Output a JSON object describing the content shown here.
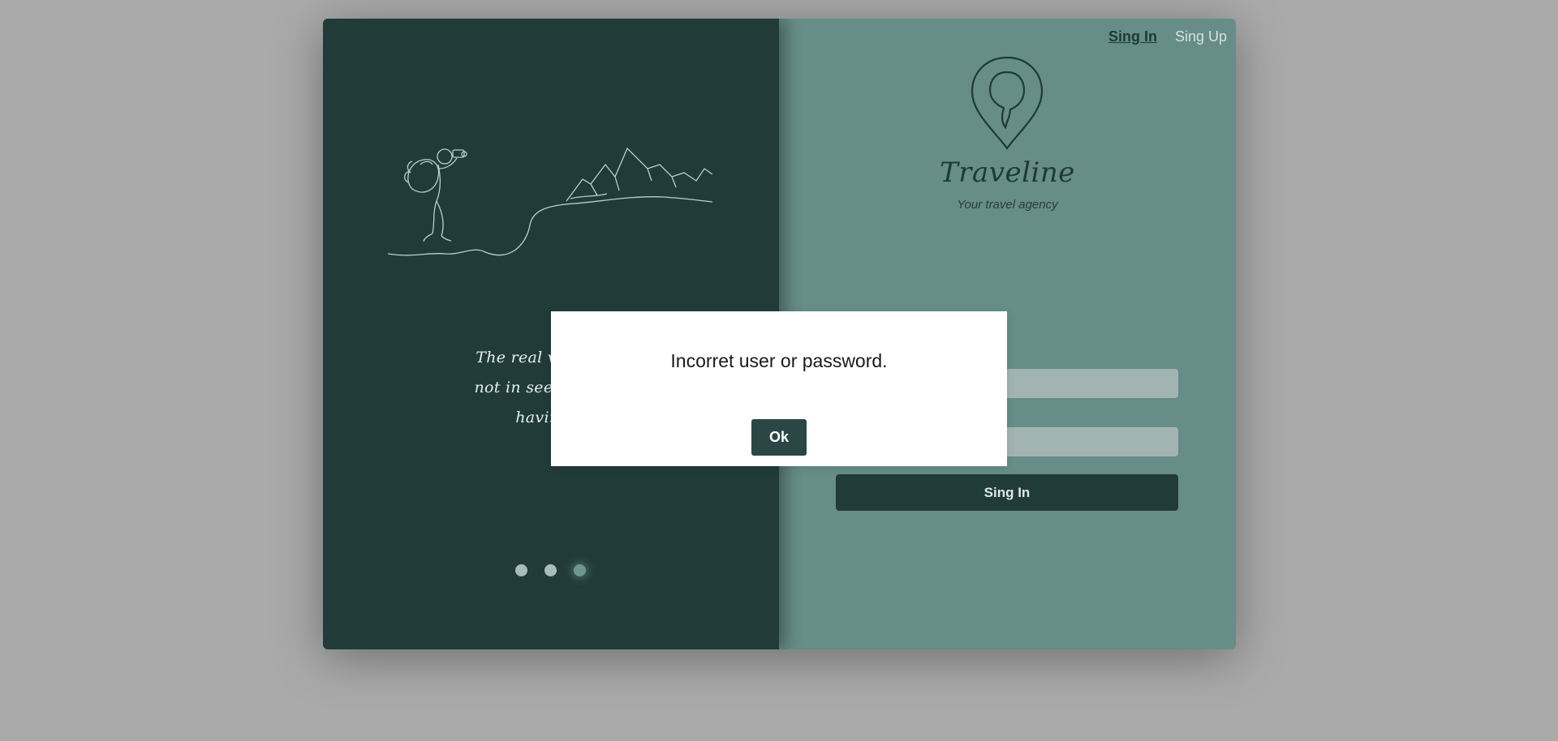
{
  "left_panel": {
    "quote_lines": [
      "The real voyage of",
      "not in seeking new",
      "having n"
    ],
    "carousel": {
      "count": 3,
      "active_index": 2
    }
  },
  "right_panel": {
    "nav": {
      "sign_in": "Sing In",
      "sign_up": "Sing Up"
    },
    "brand": {
      "name": "Traveline",
      "tagline": "Your travel agency"
    },
    "form": {
      "username_value": "",
      "password_value": "",
      "submit_label": "Sing In"
    }
  },
  "modal": {
    "message": "Incorret user or password.",
    "ok_label": "Ok"
  },
  "colors": {
    "page_background": "#aaaaaa",
    "left_panel": "#213b39",
    "right_panel": "#668d87",
    "button": "#213b39",
    "input": "#a2b4b1"
  },
  "icons": {
    "logo": "location-pin-icon",
    "illustration": "hiker-mountain-line-art"
  }
}
